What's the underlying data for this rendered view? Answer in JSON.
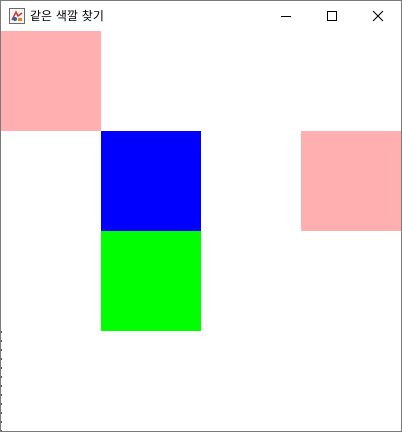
{
  "window": {
    "title": "같은 색깔 찾기",
    "icon": "java-app-icon",
    "controls": {
      "minimize_icon": "minimize-icon",
      "maximize_icon": "maximize-icon",
      "close_icon": "close-icon"
    }
  },
  "board": {
    "grid": "4x4",
    "tiles": [
      {
        "row": 0,
        "col": 0,
        "color": "#FFAFAF"
      },
      {
        "row": 1,
        "col": 1,
        "color": "#0000FF"
      },
      {
        "row": 1,
        "col": 3,
        "color": "#FFAFAF"
      },
      {
        "row": 2,
        "col": 1,
        "color": "#00FF00"
      }
    ]
  }
}
